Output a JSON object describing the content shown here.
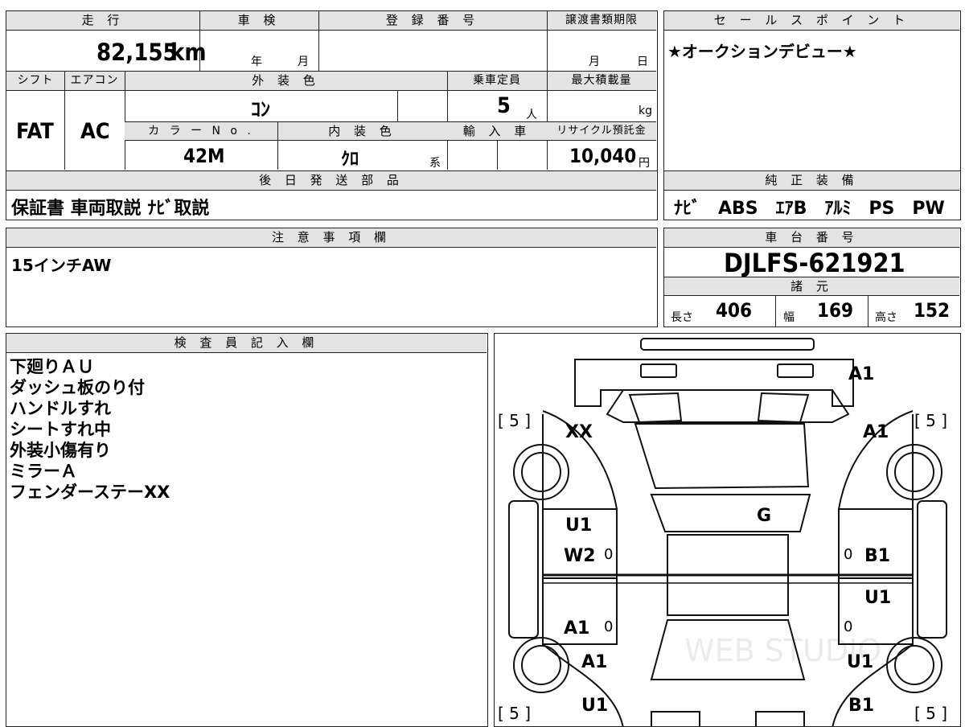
{
  "top": {
    "mileage_header": "走 行",
    "mileage_value": "82,155",
    "mileage_unit": "km",
    "shaken_header": "車 検",
    "shaken_year": "年",
    "shaken_month": "月",
    "reg_header": "登 録 番 号",
    "transfer_header": "譲渡書類期限",
    "transfer_month": "月",
    "transfer_day": "日",
    "shift_header": "シフト",
    "shift_value": "FAT",
    "ac_header": "エアコン",
    "ac_value": "AC",
    "color_header": "外 装 色",
    "color_value": "ｺﾝ",
    "capacity_header": "乗車定員",
    "capacity_value": "5",
    "capacity_unit": "人",
    "load_header": "最大積載量",
    "load_unit": "kg",
    "colorno_header": "カ ラ ー N o .",
    "colorno_value": "42M",
    "interior_header": "内 装 色",
    "interior_value": "ｸﾛ",
    "interior_unit": "系",
    "import_header": "輸 入 車",
    "recycle_header": "リサイクル預託金",
    "recycle_value": "10,040",
    "recycle_unit": "円",
    "later_header": "後 日 発 送 部 品",
    "later_value": "保証書 車両取説 ﾅﾋﾞ取説"
  },
  "sales": {
    "header": "セ ー ル ス ポ イ ン ト",
    "text": "★オークションデビュー★"
  },
  "equipment": {
    "header": "純 正 装 備",
    "text": "ﾅﾋﾞ　ABS　ｴｱB　ｱﾙﾐ　PS　PW"
  },
  "caution": {
    "header": "注 意 事 項 欄",
    "text": "15インチAW"
  },
  "chassis": {
    "header": "車 台 番 号",
    "value": "DJLFS-621921",
    "spec_header": "諸 元",
    "length_label": "長さ",
    "length_value": "406",
    "width_label": "幅",
    "width_value": "169",
    "height_label": "高さ",
    "height_value": "152"
  },
  "inspector": {
    "header": "検 査 員 記 入 欄",
    "lines": [
      "下廻りＡＵ",
      "ダッシュ板のり付",
      "ハンドルすれ",
      "シートすれ中",
      "外装小傷有り",
      "ミラーＡ",
      "フェンダーステーXX"
    ]
  },
  "diagram": {
    "tire_marks": [
      "[ 5 ]",
      "[ 5 ]",
      "[ 5 ]",
      "[ 5 ]"
    ],
    "damage": {
      "front_bumper": "A1",
      "front_left": "XX",
      "front_right": "A1",
      "windshield": "G",
      "left_front_door_1": "U1",
      "left_front_door_2": "W2",
      "right_front_door": "B1",
      "right_rear_door": "U1",
      "left_rear_door": "A1",
      "left_rear_fender": "A1",
      "right_rear_fender": "U1",
      "left_rear_bottom": "U1",
      "right_rear_bottom": "B1"
    },
    "zero_marks": [
      "0",
      "0",
      "0",
      "0"
    ],
    "watermark": "WEB STUDIO"
  }
}
